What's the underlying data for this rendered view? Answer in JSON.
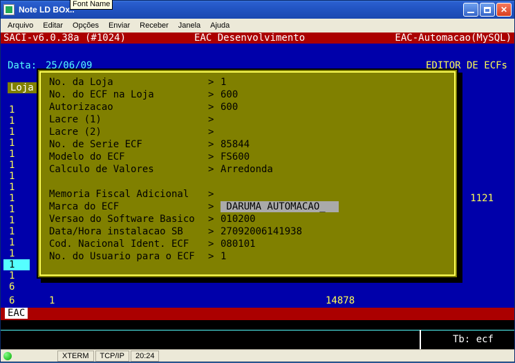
{
  "window": {
    "title": "Note LD BOx..",
    "tooltip": "Font Name"
  },
  "menubar": {
    "items": [
      "Arquivo",
      "Editar",
      "Opções",
      "Enviar",
      "Receber",
      "Janela",
      "Ajuda"
    ]
  },
  "header": {
    "left": "SACI-v6.0.38a (#1024)",
    "center": "EAC Desenvolvimento",
    "right": "EAC-Automacao(MySQL)"
  },
  "subheader": {
    "date_label": "Data:",
    "date_value": "25/06/09",
    "title": "EDITOR DE ECFs"
  },
  "col_head": "Loja",
  "bg_rows": {
    "values": [
      "1",
      "1",
      "1",
      "1",
      "1",
      "1",
      "1",
      "1",
      "1",
      "1",
      "1",
      "1",
      "1",
      "1",
      "1",
      "1",
      "6"
    ],
    "right_1121": "1121",
    "bottom_col2": "1",
    "bottom_col3": "14878"
  },
  "dialog": {
    "rows": [
      {
        "label": "No. da Loja",
        "value": "1"
      },
      {
        "label": "No. do ECF na Loja",
        "value": "600"
      },
      {
        "label": "Autorizacao",
        "value": "600"
      },
      {
        "label": "Lacre (1)",
        "value": ""
      },
      {
        "label": "Lacre (2)",
        "value": ""
      },
      {
        "label": "No. de Serie ECF",
        "value": "85844"
      },
      {
        "label": "Modelo do ECF",
        "value": "FS600"
      },
      {
        "label": "Calculo de Valores",
        "value": "Arredonda"
      },
      {
        "label": "",
        "value": ""
      },
      {
        "label": "Memoria Fiscal Adicional",
        "value": ""
      },
      {
        "label": "Marca do ECF",
        "value": "DARUMA AUTOMACAO_",
        "hilite": true
      },
      {
        "label": "Versao do Software Basico",
        "value": "010200"
      },
      {
        "label": "Data/Hora instalacao SB",
        "value": "27092006141938"
      },
      {
        "label": "Cod. Nacional Ident. ECF",
        "value": "080101"
      },
      {
        "label": "No. do Usuario para o ECF",
        "value": "1"
      }
    ]
  },
  "bottom": {
    "tag": "EAC",
    "tb": "Tb: ecf"
  },
  "status": {
    "xterm": "XTERM",
    "conn": "TCP/IP",
    "time": "20:24"
  }
}
